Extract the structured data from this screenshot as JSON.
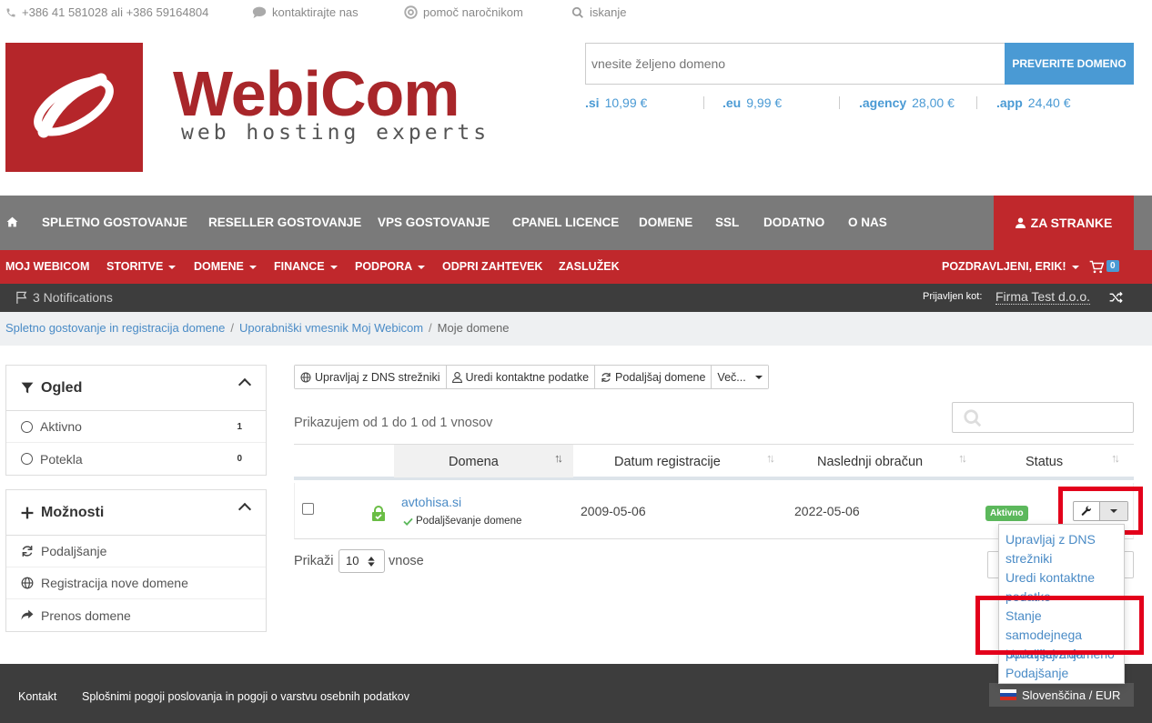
{
  "topbar": {
    "phone": "+386 41 581028 ali +386 59164804",
    "contact": "kontaktirajte nas",
    "support": "pomoč naročnikom",
    "search": "iskanje"
  },
  "logo": {
    "name": "WebiCom",
    "tagline": "web hosting experts"
  },
  "domain_search": {
    "placeholder": "vnesite željeno domeno",
    "button": "PREVERITE DOMENO",
    "tlds": [
      {
        "ext": ".si",
        "price": "10,99 €"
      },
      {
        "ext": ".eu",
        "price": "9,99 €"
      },
      {
        "ext": ".agency",
        "price": "28,00 €"
      },
      {
        "ext": ".app",
        "price": "24,40 €"
      }
    ]
  },
  "mainnav": {
    "items": [
      "SPLETNO GOSTOVANJE",
      "RESELLER GOSTOVANJE",
      "VPS GOSTOVANJE",
      "CPANEL LICENCE",
      "DOMENE",
      "SSL",
      "DODATNO",
      "O NAS"
    ],
    "client": "ZA STRANKE"
  },
  "subnav": {
    "items": [
      "MOJ WEBICOM",
      "STORITVE",
      "DOMENE",
      "FINANCE",
      "PODPORA",
      "ODPRI ZAHTEVEK",
      "ZASLUŽEK"
    ],
    "greeting": "POZDRAVLJENI, ERIK!",
    "cart_count": "0"
  },
  "infobar": {
    "notifications": "3 Notifications",
    "logged_in_label": "Prijavljen kot:",
    "company": "Firma Test d.o.o."
  },
  "breadcrumb": {
    "items": [
      "Spletno gostovanje in registracija domene",
      "Uporabniški vmesnik Moj Webicom"
    ],
    "current": "Moje domene"
  },
  "sidebar": {
    "view": {
      "title": "Ogled",
      "rows": [
        {
          "label": "Aktivno",
          "count": "1"
        },
        {
          "label": "Potekla",
          "count": "0"
        }
      ]
    },
    "options": {
      "title": "Možnosti",
      "rows": [
        "Podaljšanje",
        "Registracija nove domene",
        "Prenos domene"
      ]
    }
  },
  "toolbar": {
    "dns": "Upravljaj z DNS strežniki",
    "contact": "Uredi kontaktne podatke",
    "renew": "Podaljšaj domene",
    "more": "Več..."
  },
  "table": {
    "showing": "Prikazujem od 1 do 1 od 1 vnosov",
    "headers": [
      "Domena",
      "Datum registracije",
      "Naslednji obračun",
      "Status"
    ],
    "rows": [
      {
        "domain": "avtohisa.si",
        "note": "Podaljševanje domene",
        "registered": "2009-05-06",
        "next_billing": "2022-05-06",
        "status": "Aktivno"
      }
    ],
    "length_label": "Prikaži",
    "length_value": "10",
    "length_suffix": "vnose"
  },
  "dropdown": {
    "items": [
      "Upravljaj z DNS strežniki",
      "Uredi kontaktne podatke",
      "Stanje samodejnega podaljševanja",
      "Upravljaj z domeno",
      "Podajšanje"
    ]
  },
  "footer": {
    "contact": "Kontakt",
    "terms": "Splošnimi pogoji poslovanja in pogoji o varstvu osebnih podatkov",
    "language": "Slovenščina / EUR"
  },
  "colors": {
    "brand_red": "#c0282c",
    "accent_blue": "#4a9ad4",
    "nav_gray": "#7a7a7a",
    "highlight": "#e3001b",
    "active_green": "#5cb85c"
  }
}
